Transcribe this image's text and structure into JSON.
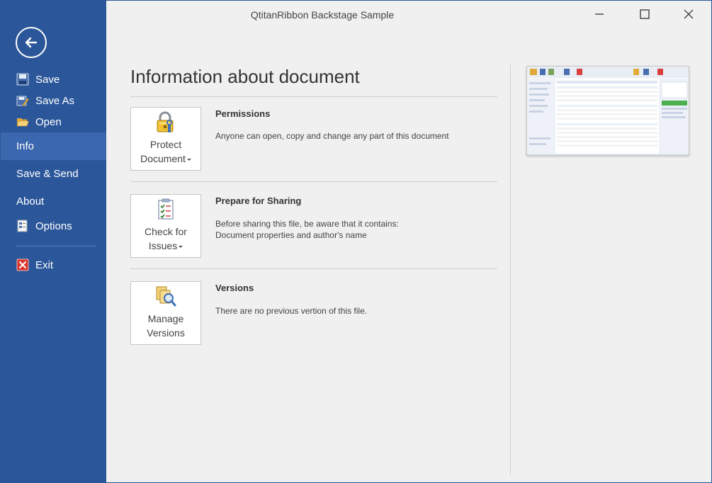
{
  "window": {
    "title": "QtitanRibbon Backstage Sample"
  },
  "sidebar": {
    "commands": [
      {
        "label": "Save",
        "icon": "floppy-disk-icon"
      },
      {
        "label": "Save As",
        "icon": "save-as-icon"
      },
      {
        "label": "Open",
        "icon": "folder-open-icon"
      }
    ],
    "tabs": [
      {
        "label": "Info",
        "active": true
      },
      {
        "label": "Save & Send",
        "active": false
      },
      {
        "label": "About",
        "active": false
      }
    ],
    "options_label": "Options",
    "exit_label": "Exit"
  },
  "main": {
    "page_title": "Information about document",
    "sections": [
      {
        "button_line1": "Protect",
        "button_line2": "Document",
        "heading": "Permissions",
        "text_lines": [
          "Anyone can open, copy and change any part of this document"
        ]
      },
      {
        "button_line1": "Check for",
        "button_line2": "Issues",
        "heading": "Prepare for Sharing",
        "text_lines": [
          "Before sharing this file, be aware that it contains:",
          "Document properties and author's name"
        ]
      },
      {
        "button_line1": "Manage",
        "button_line2": "Versions",
        "heading": "Versions",
        "text_lines": [
          "There are no previous vertion of this file."
        ]
      }
    ]
  },
  "colors": {
    "backstage_blue": "#2b579a",
    "active_tab": "#3a67ad",
    "content_bg": "#f0f0f0"
  }
}
